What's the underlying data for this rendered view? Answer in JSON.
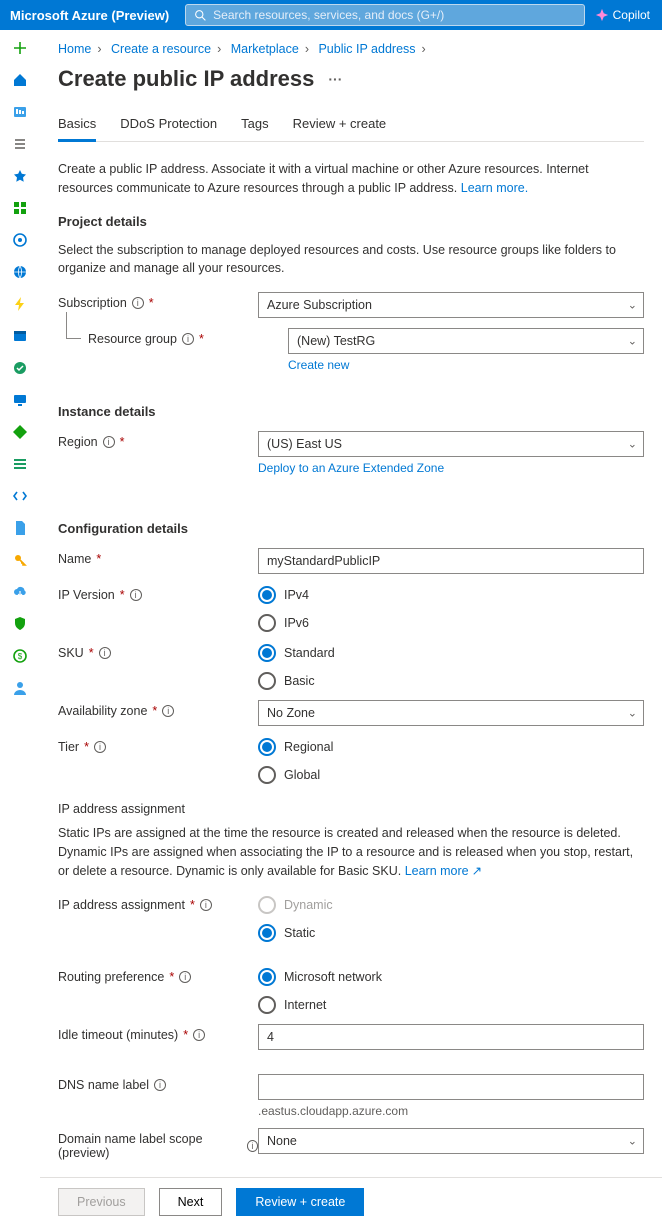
{
  "topbar": {
    "brand": "Microsoft Azure (Preview)",
    "search_placeholder": "Search resources, services, and docs (G+/)",
    "copilot": "Copilot"
  },
  "rail_icons": [
    "plus",
    "home",
    "dashboard",
    "list",
    "star",
    "grid",
    "globe-ring",
    "globe",
    "bolt",
    "storage",
    "monitor",
    "display",
    "diamond",
    "bars",
    "code",
    "doc-blue",
    "key",
    "cloud-down",
    "shield",
    "circle-green",
    "person"
  ],
  "breadcrumb": {
    "items": [
      "Home",
      "Create a resource",
      "Marketplace",
      "Public IP address"
    ]
  },
  "title": "Create public IP address",
  "tabs": [
    "Basics",
    "DDoS Protection",
    "Tags",
    "Review + create"
  ],
  "active_tab": 0,
  "intro": {
    "text": "Create a public IP address. Associate it with a virtual machine or other Azure resources. Internet resources communicate to Azure resources through a public IP address. ",
    "link": "Learn more."
  },
  "project_details": {
    "heading": "Project details",
    "desc": "Select the subscription to manage deployed resources and costs. Use resource groups like folders to organize and manage all your resources.",
    "subscription_label": "Subscription",
    "subscription_value": "Azure Subscription",
    "rg_label": "Resource group",
    "rg_value": "(New) TestRG",
    "rg_create_link": "Create new"
  },
  "instance_details": {
    "heading": "Instance details",
    "region_label": "Region",
    "region_value": "(US) East US",
    "zone_link": "Deploy to an Azure Extended Zone"
  },
  "config": {
    "heading": "Configuration details",
    "name_label": "Name",
    "name_value": "myStandardPublicIP",
    "ipver_label": "IP Version",
    "ipver_options": [
      "IPv4",
      "IPv6"
    ],
    "ipver_selected": 0,
    "sku_label": "SKU",
    "sku_options": [
      "Standard",
      "Basic"
    ],
    "sku_selected": 0,
    "az_label": "Availability zone",
    "az_value": "No Zone",
    "tier_label": "Tier",
    "tier_options": [
      "Regional",
      "Global"
    ],
    "tier_selected": 0,
    "assign_heading": "IP address assignment",
    "assign_desc_pre": "Static IPs are assigned at the time the resource is created and released when the resource is deleted. Dynamic IPs are assigned when associating the IP to a resource and is released when you stop, restart, or delete a resource. Dynamic is only available for Basic SKU. ",
    "assign_desc_link": "Learn more",
    "assign_label": "IP address assignment",
    "assign_options": [
      "Dynamic",
      "Static"
    ],
    "assign_selected": 1,
    "assign_disabled": [
      true,
      false
    ],
    "routing_label": "Routing preference",
    "routing_options": [
      "Microsoft network",
      "Internet"
    ],
    "routing_selected": 0,
    "idle_label": "Idle timeout (minutes)",
    "idle_value": "4",
    "dns_label": "DNS name label",
    "dns_value": "",
    "dns_suffix": ".eastus.cloudapp.azure.com",
    "scope_label": "Domain name label scope (preview)",
    "scope_value": "None"
  },
  "footer": {
    "previous": "Previous",
    "next": "Next",
    "review": "Review + create"
  },
  "colors": {
    "azure_blue": "#0078d4"
  }
}
